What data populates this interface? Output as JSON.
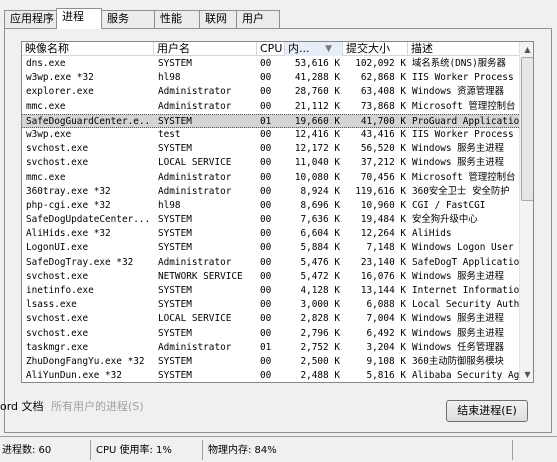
{
  "tabs": [
    "应用程序",
    "进程",
    "服务",
    "性能",
    "联网",
    "用户"
  ],
  "active_tab": 1,
  "columns": {
    "name": "映像名称",
    "user": "用户名",
    "cpu": "CPU",
    "mem": "内...",
    "commit": "提交大小",
    "desc": "描述"
  },
  "sorted_column_icon": "sort-descending-icon",
  "processes": [
    {
      "name": "dns.exe",
      "user": "SYSTEM",
      "cpu": "00",
      "mem": "53,616 K",
      "commit": "102,092 K",
      "desc": "域名系统(DNS)服务器"
    },
    {
      "name": "w3wp.exe *32",
      "user": "hl98",
      "cpu": "00",
      "mem": "41,288 K",
      "commit": "62,868 K",
      "desc": "IIS Worker Process"
    },
    {
      "name": "explorer.exe",
      "user": "Administrator",
      "cpu": "00",
      "mem": "28,760 K",
      "commit": "63,408 K",
      "desc": "Windows 资源管理器"
    },
    {
      "name": "mmc.exe",
      "user": "Administrator",
      "cpu": "00",
      "mem": "21,112 K",
      "commit": "73,868 K",
      "desc": "Microsoft 管理控制台"
    },
    {
      "name": "SafeDogGuardCenter.e...",
      "user": "SYSTEM",
      "cpu": "01",
      "mem": "19,660 K",
      "commit": "41,700 K",
      "desc": "ProGuard Application"
    },
    {
      "name": "w3wp.exe",
      "user": "test",
      "cpu": "00",
      "mem": "12,416 K",
      "commit": "43,416 K",
      "desc": "IIS Worker Process"
    },
    {
      "name": "svchost.exe",
      "user": "SYSTEM",
      "cpu": "00",
      "mem": "12,172 K",
      "commit": "56,520 K",
      "desc": "Windows 服务主进程"
    },
    {
      "name": "svchost.exe",
      "user": "LOCAL SERVICE",
      "cpu": "00",
      "mem": "11,040 K",
      "commit": "37,212 K",
      "desc": "Windows 服务主进程"
    },
    {
      "name": "mmc.exe",
      "user": "Administrator",
      "cpu": "00",
      "mem": "10,080 K",
      "commit": "70,456 K",
      "desc": "Microsoft 管理控制台"
    },
    {
      "name": "360tray.exe *32",
      "user": "Administrator",
      "cpu": "00",
      "mem": "8,924 K",
      "commit": "119,616 K",
      "desc": "360安全卫士 安全防护"
    },
    {
      "name": "php-cgi.exe *32",
      "user": "hl98",
      "cpu": "00",
      "mem": "8,696 K",
      "commit": "10,960 K",
      "desc": "CGI / FastCGI"
    },
    {
      "name": "SafeDogUpdateCenter....",
      "user": "SYSTEM",
      "cpu": "00",
      "mem": "7,636 K",
      "commit": "19,484 K",
      "desc": "安全狗升级中心"
    },
    {
      "name": "AliHids.exe *32",
      "user": "SYSTEM",
      "cpu": "00",
      "mem": "6,604 K",
      "commit": "12,264 K",
      "desc": "AliHids"
    },
    {
      "name": "LogonUI.exe",
      "user": "SYSTEM",
      "cpu": "00",
      "mem": "5,884 K",
      "commit": "7,148 K",
      "desc": "Windows Logon User I"
    },
    {
      "name": "SafeDogTray.exe *32",
      "user": "Administrator",
      "cpu": "00",
      "mem": "5,476 K",
      "commit": "23,140 K",
      "desc": "SafeDogT Application"
    },
    {
      "name": "svchost.exe",
      "user": "NETWORK SERVICE",
      "cpu": "00",
      "mem": "5,472 K",
      "commit": "16,076 K",
      "desc": "Windows 服务主进程"
    },
    {
      "name": "inetinfo.exe",
      "user": "SYSTEM",
      "cpu": "00",
      "mem": "4,128 K",
      "commit": "13,144 K",
      "desc": "Internet Information"
    },
    {
      "name": "lsass.exe",
      "user": "SYSTEM",
      "cpu": "00",
      "mem": "3,000 K",
      "commit": "6,088 K",
      "desc": "Local Security Autho"
    },
    {
      "name": "svchost.exe",
      "user": "LOCAL SERVICE",
      "cpu": "00",
      "mem": "2,828 K",
      "commit": "7,004 K",
      "desc": "Windows 服务主进程"
    },
    {
      "name": "svchost.exe",
      "user": "SYSTEM",
      "cpu": "00",
      "mem": "2,796 K",
      "commit": "6,492 K",
      "desc": "Windows 服务主进程"
    },
    {
      "name": "taskmgr.exe",
      "user": "Administrator",
      "cpu": "01",
      "mem": "2,752 K",
      "commit": "3,204 K",
      "desc": "Windows 任务管理器"
    },
    {
      "name": "ZhuDongFangYu.exe *32",
      "user": "SYSTEM",
      "cpu": "00",
      "mem": "2,500 K",
      "commit": "9,108 K",
      "desc": "360主动防御服务模块"
    },
    {
      "name": "AliYunDun.exe *32",
      "user": "SYSTEM",
      "cpu": "00",
      "mem": "2,488 K",
      "commit": "5,816 K",
      "desc": "Alibaba Security Age"
    }
  ],
  "selected_row": 4,
  "show_all_users": {
    "word_prefix": "ord 文档",
    "label": "所有用户的进程(S)"
  },
  "end_process_button": "结束进程(E)",
  "status": {
    "processes": "进程数: 60",
    "cpu": "CPU 使用率: 1%",
    "memory": "物理内存: 84%"
  }
}
